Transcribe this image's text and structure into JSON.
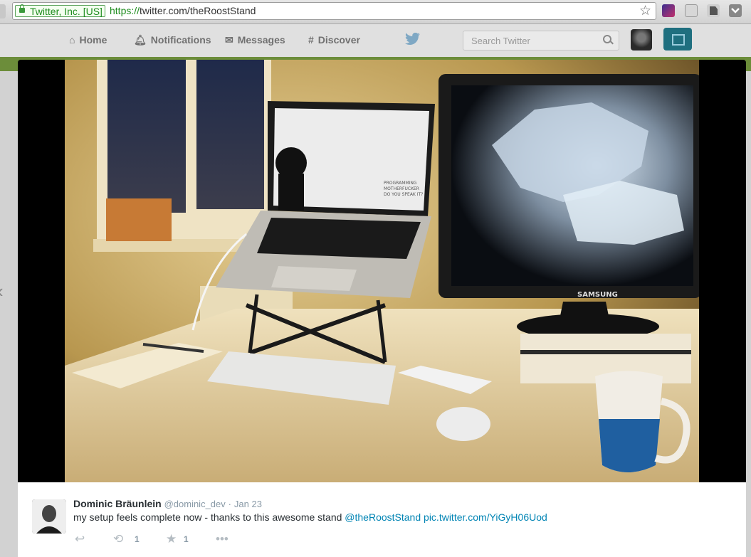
{
  "browser": {
    "ev_label": "Twitter, Inc. [US]",
    "url_scheme": "https://",
    "url_rest": "twitter.com/theRoostStand"
  },
  "nav": {
    "home": "Home",
    "notifications": "Notifications",
    "messages": "Messages",
    "discover": "Discover",
    "search_placeholder": "Search Twitter"
  },
  "tweet": {
    "fullname": "Dominic Bräunlein",
    "handle": "@dominic_dev",
    "separator": "·",
    "date": "Jan 23",
    "text": "my setup feels complete now - thanks to this awesome stand",
    "mention": "@theRoostStand",
    "media_link": "pic.twitter.com/YiGyH06Uod",
    "retweet_count": "1",
    "favorite_count": "1"
  },
  "photo_screen": {
    "line1": "PROGRAMMING",
    "line2": "MOTHERFUCKER",
    "line3": "DO YOU SPEAK IT?",
    "monitor_brand": "SAMSUNG"
  },
  "colors": {
    "link": "#0084b4",
    "accent_green": "#6c8d3a",
    "compose": "#1f6f7f"
  },
  "icons": [
    "lock-icon",
    "star-icon",
    "home-icon",
    "bell-icon",
    "envelope-icon",
    "hashtag-icon",
    "twitter-bird-icon",
    "search-icon",
    "compose-icon",
    "reply-icon",
    "retweet-icon",
    "favorite-icon",
    "more-icon",
    "chevron-left-icon"
  ]
}
